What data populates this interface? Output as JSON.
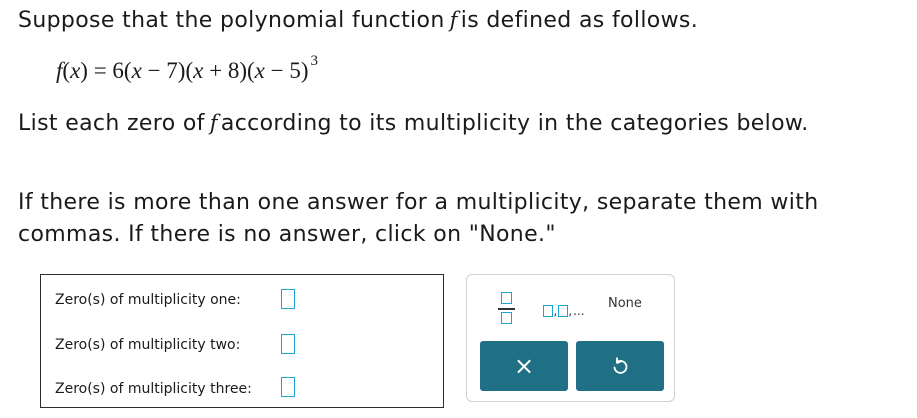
{
  "question": {
    "line1_pre": "Suppose that the polynomial function",
    "fn_symbol": "f",
    "line1_post": "is defined as follows.",
    "formula": {
      "lhs_fn": "f",
      "lhs_var": "x",
      "coef": "6",
      "f1_var": "x",
      "f1_sign": "−",
      "f1_num": "7",
      "f2_var": "x",
      "f2_sign": "+",
      "f2_num": "8",
      "f3_var": "x",
      "f3_sign": "−",
      "f3_num": "5",
      "exponent": "3"
    },
    "line2_pre": "List each zero of",
    "line2_post": "according to its multiplicity in the categories below.",
    "line3": "If there is more than one answer for a multiplicity, separate them with",
    "line4": "commas. If there is no answer, click on \"None.\""
  },
  "answers": {
    "rows": [
      {
        "label": "Zero(s) of multiplicity one:",
        "value": ""
      },
      {
        "label": "Zero(s) of multiplicity two:",
        "value": ""
      },
      {
        "label": "Zero(s) of multiplicity three:",
        "value": ""
      }
    ]
  },
  "toolbox": {
    "list_ellipsis": "...",
    "none_label": "None",
    "clear_symbol": "×",
    "undo_icon": "undo-icon",
    "fraction_icon": "fraction-icon",
    "list_icon": "list-icon",
    "button_color": "#1f6f85",
    "accent_color": "#1ba3d6"
  }
}
